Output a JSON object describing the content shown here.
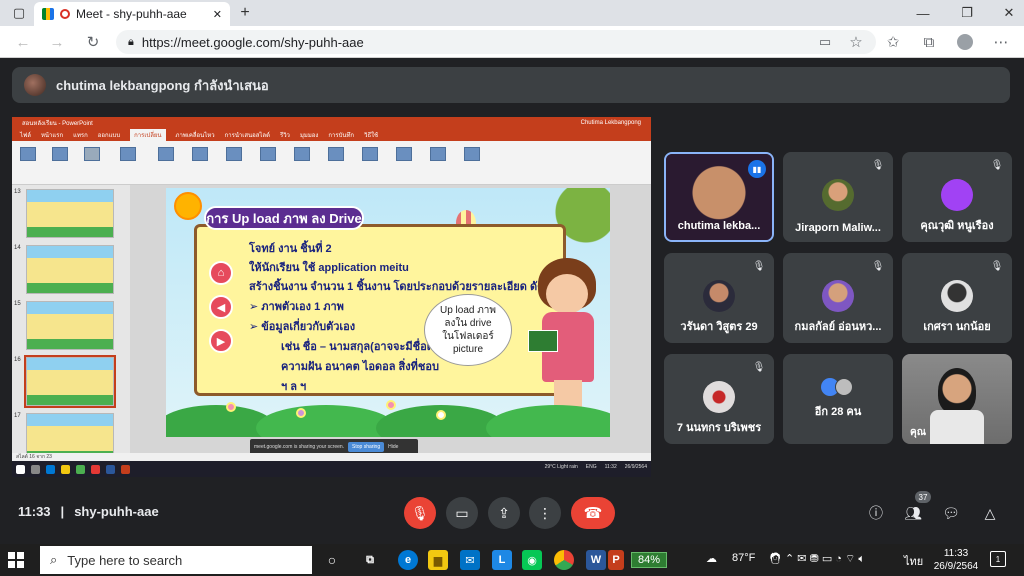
{
  "browser": {
    "tab_title": "Meet - shy-puhh-aae",
    "new_tab": "+",
    "url": "https://meet.google.com/shy-puhh-aae"
  },
  "presenter": {
    "label": "chutima lekbangpong กำลังนำเสนอ"
  },
  "screen": {
    "pp_title_left": "สอนหลังเรียน - PowerPoint",
    "pp_title_right": "Chutima Lekbangpong",
    "pp_tabs": [
      "ไฟล์",
      "หน้าแรก",
      "แทรก",
      "ออกแบบ",
      "การเปลี่ยน",
      "ภาพเคลื่อนไหว",
      "การนำเสนอสไลด์",
      "รีวิว",
      "มุมมอง",
      "การบันทึก",
      "วิธีใช้"
    ],
    "thumb_numbers": [
      "13",
      "14",
      "15",
      "16",
      "17"
    ],
    "slide": {
      "title": "การ Up load ภาพ ลง Drive",
      "lines": [
        "โจทย์   งาน ชิ้นที่ 2",
        "ให้นักเรียน ใช้ application meitu",
        "สร้างชิ้นงาน จำนวน 1 ชิ้นงาน โดยประกอบด้วยรายละเอียด ดังนี้",
        "➢  ภาพตัวเอง 1 ภาพ",
        "➢  ข้อมูลเกี่ยวกับตัวเอง",
        "เช่น ชื่อ – นามสกุล(อาจจะมีชื่อเล่น)",
        "ความฝัน  อนาคต  ไอดอล สิ่งที่ชอบ",
        "ฯ ล ฯ"
      ],
      "bubble": [
        "Up load ภาพ",
        "ลงใน drive",
        "ในโฟลเดอร์",
        "picture"
      ]
    },
    "share_note": {
      "text": "meet.google.com is sharing your screen.",
      "stop": "Stop sharing",
      "hide": "Hide"
    },
    "pp_status": "สไลด์ 16 จาก 23",
    "inner_tray": {
      "weather": "29°C  Light rain",
      "lang": "ENG",
      "time": "11:32",
      "date": "26/9/2564"
    }
  },
  "tiles": [
    {
      "name": "chutima lekba...",
      "talking": true
    },
    {
      "name": "Jiraporn Maliw...",
      "muted": true
    },
    {
      "name": "คุณวุฒิ หนูเรือง",
      "muted": true
    },
    {
      "name": "วรันดา วิสูตร 29",
      "muted": true
    },
    {
      "name": "กมลกัลย์ อ่อนหว...",
      "muted": true
    },
    {
      "name": "เกศรา นกน้อย",
      "muted": true
    },
    {
      "name": "7 นนทกร บริเพชร",
      "muted": true
    },
    {
      "name": "อีก 28 คน"
    },
    {
      "name": "คุณ"
    }
  ],
  "meet": {
    "time": "11:33",
    "separator": "|",
    "code": "shy-puhh-aae",
    "participant_count": "37"
  },
  "taskbar": {
    "search_placeholder": "Type here to search",
    "battery": "84%",
    "temp": "87°F",
    "lang": "ไทย",
    "time": "11:33",
    "date": "26/9/2564",
    "notif": "1"
  },
  "colors": {
    "meet_bg": "#202124",
    "tile_bg": "#3c4043",
    "hangup": "#ea4335",
    "ppt_red": "#c43e1c",
    "active_border": "#8ab4f8"
  }
}
